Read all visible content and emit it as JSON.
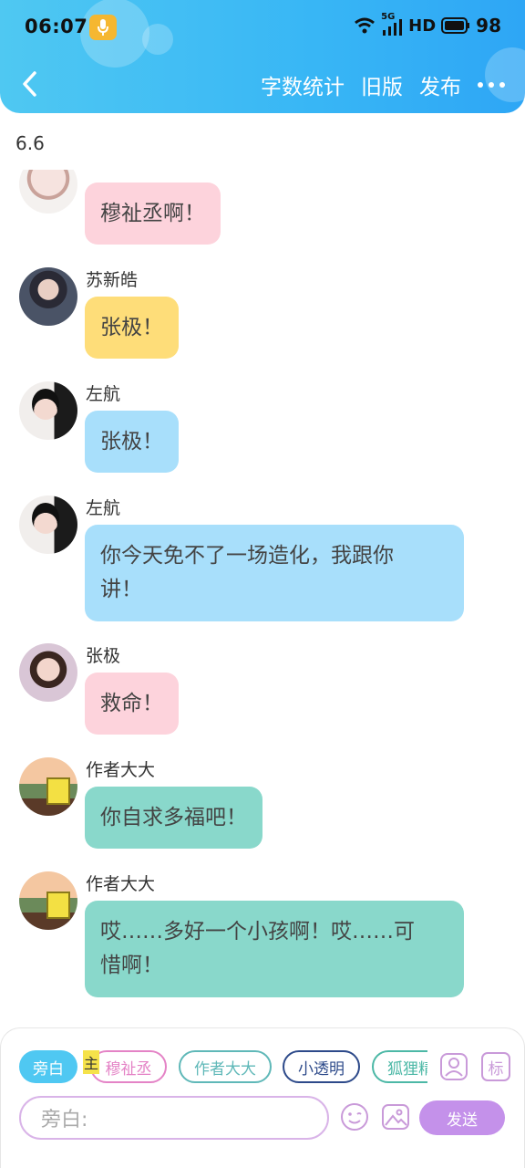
{
  "status_bar": {
    "time": "06:07",
    "network": "5G",
    "hd": "HD",
    "battery": "98"
  },
  "nav": {
    "actions": [
      {
        "label": "字数统计"
      },
      {
        "label": "旧版"
      },
      {
        "label": "发布"
      }
    ]
  },
  "date_label": "6.6",
  "messages": [
    {
      "sender": "",
      "text": "穆祉丞啊！",
      "bubble_color": "#fdd3dc"
    },
    {
      "sender": "苏新皓",
      "text": "张极！",
      "bubble_color": "#fedd79"
    },
    {
      "sender": "左航",
      "text": "张极！",
      "bubble_color": "#a8dffb"
    },
    {
      "sender": "左航",
      "text_lines": [
        "你今天免不了一场造化，我跟你",
        "讲！"
      ],
      "bubble_color": "#a8dffb"
    },
    {
      "sender": "张极",
      "text": "救命！",
      "bubble_color": "#fdd3dc"
    },
    {
      "sender": "作者大大",
      "text": "你自求多福吧！",
      "bubble_color": "#89d8cb"
    },
    {
      "sender": "作者大大",
      "text_lines": [
        "哎……多好一个小孩啊！哎……可",
        "惜啊！"
      ],
      "bubble_color": "#89d8cb"
    }
  ],
  "roles": [
    {
      "label": "旁白",
      "selected": true
    },
    {
      "label": "穆祉丞",
      "color": "#e483c6"
    },
    {
      "label": "作者大大",
      "color": "#5fb8b8"
    },
    {
      "label": "小透明",
      "color": "#2d4a8a"
    },
    {
      "label": "狐狸精",
      "color": "#4cb8a6"
    }
  ],
  "host_tag": "主",
  "role_icons": {
    "person": "person-icon",
    "tag": "标"
  },
  "input": {
    "placeholder": "旁白:"
  },
  "send_label": "发送",
  "colors": {
    "header": "#38b6f5",
    "send": "#c491ea",
    "chip_selected": "#4fc8f2"
  }
}
